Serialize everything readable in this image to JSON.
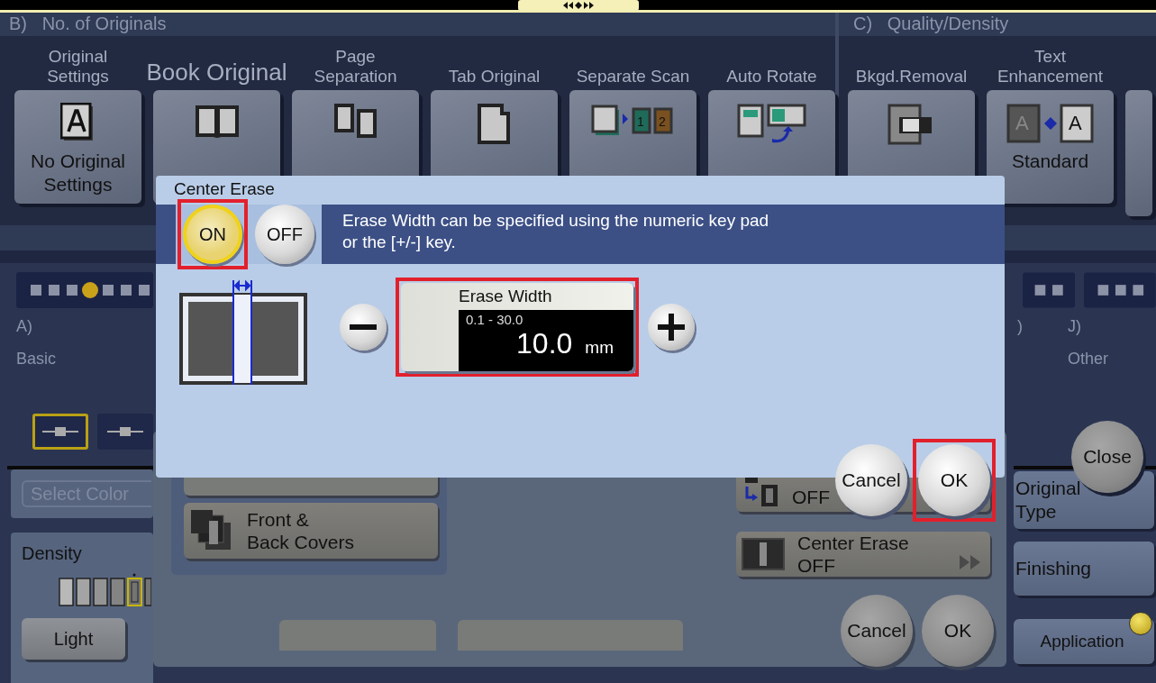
{
  "sections": [
    {
      "letter": "B)",
      "title": "No. of Originals"
    },
    {
      "letter": "C)",
      "title": "Quality/Density"
    }
  ],
  "tiles_originals": [
    {
      "label": "Original\nSettings",
      "value": "No Original\nSettings",
      "kind": "original",
      "emphasis": false
    },
    {
      "label": "Book Original",
      "kind": "book",
      "emphasis": true
    },
    {
      "label": "Page\nSeparation",
      "kind": "pages",
      "emphasis": false
    },
    {
      "label": "Tab Original",
      "kind": "tab",
      "emphasis": false
    },
    {
      "label": "Separate Scan",
      "kind": "separate",
      "emphasis": false,
      "marks": [
        "1",
        "2"
      ]
    },
    {
      "label": "Auto Rotate",
      "kind": "rotate",
      "emphasis": false
    }
  ],
  "tiles_quality": [
    {
      "label": "Bkgd.Removal",
      "kind": "bleed",
      "emphasis": false
    },
    {
      "label": "Text\nEnhancement",
      "value": "Standard",
      "kind": "text",
      "emphasis": false,
      "marks": [
        "A",
        "A"
      ]
    }
  ],
  "categories_left": [
    {
      "letter": "A)",
      "name": "Basic"
    }
  ],
  "categories_right": [
    {
      "letter": ")"
    },
    {
      "letter": "J)",
      "name": "Other"
    }
  ],
  "modes": [
    {
      "selected": true
    },
    {
      "selected": false
    }
  ],
  "color_field": {
    "placeholder": "Select Color"
  },
  "density": {
    "label": "Density",
    "button": "Light"
  },
  "close_button": "Close",
  "side_buttons": [
    "Original\nType",
    "Finishing"
  ],
  "application": {
    "label": "Application",
    "indicator": true
  },
  "back_panel": {
    "covers_button": "Front &\nBack Covers",
    "flat_value": "OFF",
    "center_erase": {
      "label": "Center Erase",
      "value": "OFF"
    },
    "buttons": [
      "Cancel",
      "OK"
    ]
  },
  "dialog": {
    "title": "Center Erase",
    "toggle": [
      {
        "label": "ON",
        "selected": true,
        "highlighted": true
      },
      {
        "label": "OFF",
        "selected": false,
        "highlighted": false
      }
    ],
    "message": "Erase Width can be specified using the numeric key pad\nor the [+/-] key.",
    "field": {
      "label": "Erase Width",
      "range": "0.1 - 30.0",
      "value": "10.0",
      "unit": "mm",
      "highlighted": true
    },
    "buttons": [
      {
        "label": "Cancel",
        "highlighted": false
      },
      {
        "label": "OK",
        "highlighted": true
      }
    ]
  }
}
